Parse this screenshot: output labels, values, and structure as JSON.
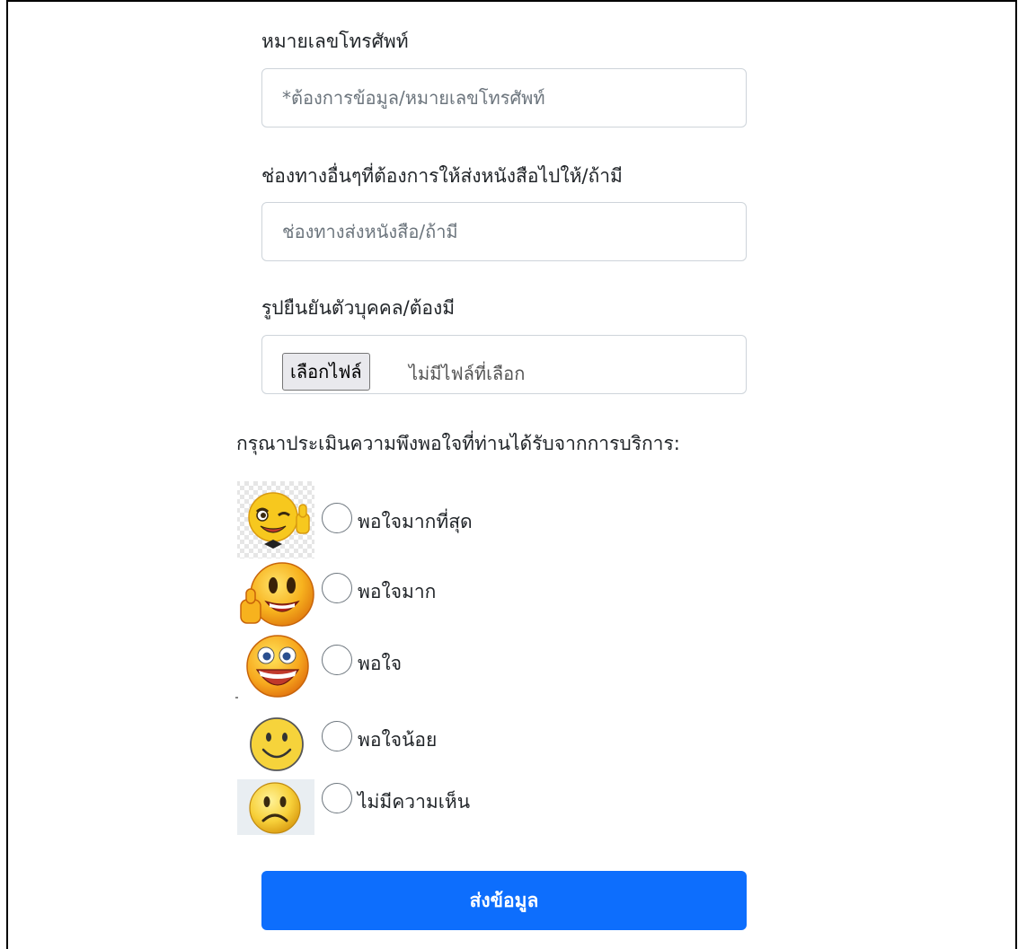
{
  "phone": {
    "label": "หมายเลขโทรศัพท์",
    "placeholder": "*ต้องการข้อมูล/หมายเลขโทรศัพท์",
    "value": ""
  },
  "channel": {
    "label": "ช่องทางอื่นๆที่ต้องการให้ส่งหนังสือไปให้/ถ้ามี",
    "placeholder": "ช่องทางส่งหนังสือ/ถ้ามี",
    "value": ""
  },
  "id_photo": {
    "label": "รูปยืนยันตัวบุคคล/ต้องมี",
    "button_label": "เลือกไฟล์",
    "status": "ไม่มีไฟล์ที่เลือก"
  },
  "rating": {
    "question": "กรุณาประเมินความพึงพอใจที่ท่านได้รับจากการบริการ:",
    "options": [
      {
        "label": "พอใจมากที่สุด",
        "icon": "winking-thumbs-up-emoji-icon",
        "selected": false
      },
      {
        "label": "พอใจมาก",
        "icon": "thumbs-up-smiley-icon",
        "selected": false
      },
      {
        "label": "พอใจ",
        "icon": "big-grin-emoji-icon",
        "selected": false
      },
      {
        "label": "พอใจน้อย",
        "icon": "simple-smile-emoji-icon",
        "selected": false
      },
      {
        "label": "ไม่มีความเห็น",
        "icon": "frown-emoji-icon",
        "selected": false
      }
    ]
  },
  "submit_label": "ส่งข้อมูล",
  "colors": {
    "primary": "#0d6efd",
    "input_border": "#ced4da",
    "placeholder": "#6c757d",
    "emoji_yellow": "#f7c81e",
    "emoji_orange": "#f29a1a"
  }
}
